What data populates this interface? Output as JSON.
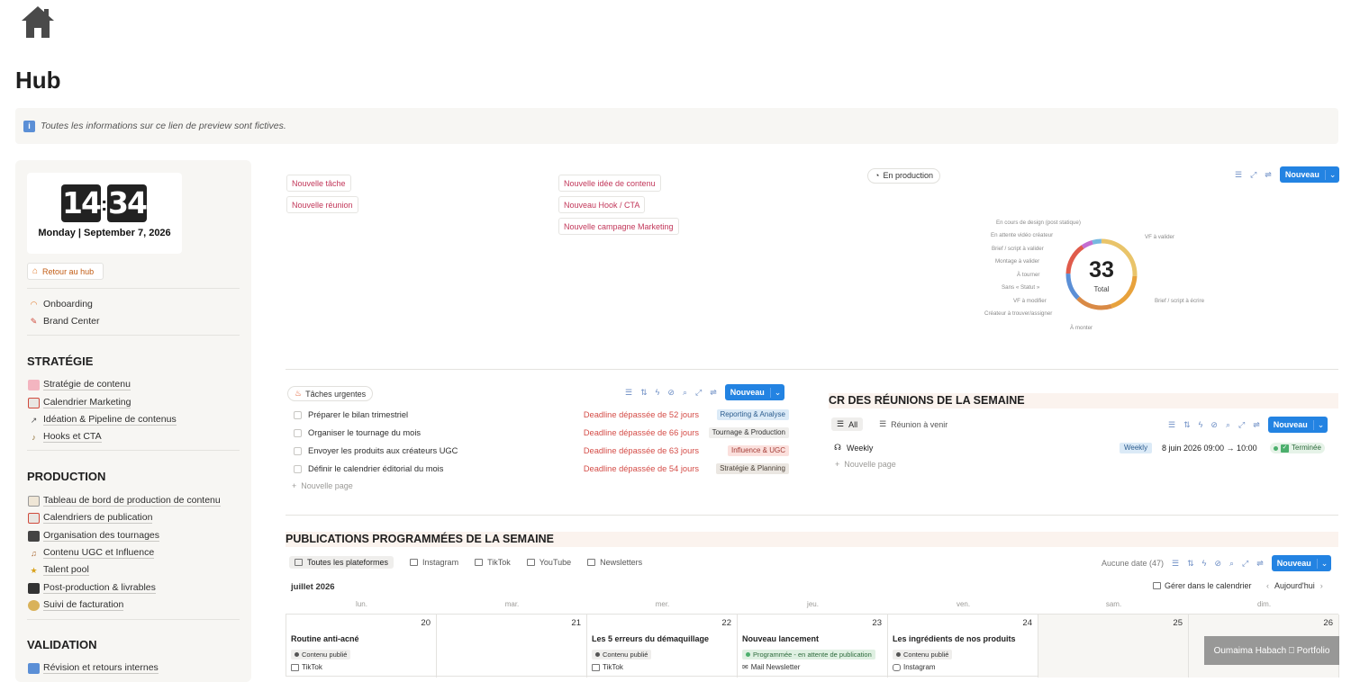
{
  "page": {
    "title": "Hub",
    "callout": "Toutes les informations sur ce lien de preview sont fictives."
  },
  "clock": {
    "hours": "14",
    "minutes": "34",
    "date": "Monday | September 7, 2026"
  },
  "sidebar": {
    "back_label": "Retour au hub",
    "top_items": [
      {
        "label": "Onboarding",
        "icon": "rainbow-icon"
      },
      {
        "label": "Brand Center",
        "icon": "pin-icon"
      }
    ],
    "sections": [
      {
        "title": "STRATÉGIE",
        "items": [
          {
            "label": "Stratégie de contenu",
            "icon": "brain-icon"
          },
          {
            "label": "Calendrier Marketing",
            "icon": "calendar-icon"
          },
          {
            "label": "Idéation & Pipeline de contenus",
            "icon": "arrow-icon"
          },
          {
            "label": "Hooks et CTA",
            "icon": "hook-icon"
          }
        ]
      },
      {
        "title": "PRODUCTION",
        "items": [
          {
            "label": "Tableau de bord de production de contenu",
            "icon": "notepad-icon"
          },
          {
            "label": "Calendriers de publication",
            "icon": "calendar-icon"
          },
          {
            "label": "Organisation des tournages",
            "icon": "camera-icon"
          },
          {
            "label": "Contenu UGC et Influence",
            "icon": "guitar-icon"
          },
          {
            "label": "Talent pool",
            "icon": "star-icon"
          },
          {
            "label": "Post-production & livrables",
            "icon": "screen-icon"
          },
          {
            "label": "Suivi de facturation",
            "icon": "money-bag-icon"
          }
        ]
      },
      {
        "title": "VALIDATION",
        "items": [
          {
            "label": "Révision et retours internes",
            "icon": "refresh-icon"
          }
        ]
      }
    ]
  },
  "quick_buttons": {
    "col1": [
      "Nouvelle tâche",
      "Nouvelle réunion"
    ],
    "col2": [
      "Nouvelle idée de contenu",
      "Nouveau Hook / CTA",
      "Nouvelle campagne Marketing"
    ]
  },
  "production": {
    "view_label": "En production",
    "new_label": "Nouveau",
    "total": "33",
    "total_label": "Total",
    "labels_left": [
      "En cours de design (post statique)",
      "En attente vidéo créateur",
      "Brief / script à valider",
      "Montage à valider",
      "À tourner",
      "Sans « Statut »",
      "VF à modifier",
      "Créateur à trouver/assigner"
    ],
    "labels_right": [
      "VF à valider",
      "Brief / script à écrire"
    ],
    "label_bottom": "À monter",
    "colors": [
      "#e8a23c",
      "#d98a46",
      "#5b8fd6",
      "#e05b4b",
      "#c46dd0",
      "#76b8e0",
      "#e9c46a"
    ]
  },
  "urgent": {
    "view_label": "Tâches urgentes",
    "new_label": "Nouveau",
    "new_page": "Nouvelle page",
    "rows": [
      {
        "title": "Préparer le bilan trimestriel",
        "deadline": "Deadline dépassée de 52 jours",
        "category": "Reporting & Analyse",
        "bg": "#dbeaf7",
        "fg": "#2c5d8f"
      },
      {
        "title": "Organiser le tournage du mois",
        "deadline": "Deadline dépassée de 66 jours",
        "category": "Tournage & Production",
        "bg": "#efeeec",
        "fg": "#333333"
      },
      {
        "title": "Envoyer les produits aux créateurs UGC",
        "deadline": "Deadline dépassée de 63 jours",
        "category": "Influence & UGC",
        "bg": "#fbe0dd",
        "fg": "#a33b35"
      },
      {
        "title": "Définir le calendrier éditorial du mois",
        "deadline": "Deadline dépassée de 54 jours",
        "category": "Stratégie & Planning",
        "bg": "#ebe7e2",
        "fg": "#4a4036"
      }
    ]
  },
  "meetings": {
    "title": "CR DES RÉUNIONS DE LA SEMAINE",
    "tab_all": "All",
    "tab_upcoming": "Réunion à venir",
    "new_label": "Nouveau",
    "new_page": "Nouvelle page",
    "row": {
      "title": "Weekly",
      "tag": "Weekly",
      "date": "8 juin 2026 09:00 → 10:00",
      "status": "Terminée"
    }
  },
  "publications": {
    "title": "PUBLICATIONS PROGRAMMÉES DE LA SEMAINE",
    "tabs": [
      "Toutes les plateformes",
      "Instagram",
      "TikTok",
      "YouTube",
      "Newsletters"
    ],
    "no_date": "Aucune date (47)",
    "new_label": "Nouveau",
    "month": "juillet 2026",
    "manage": "Gérer dans le calendrier",
    "today": "Aujourd'hui",
    "days": [
      "lun.",
      "mar.",
      "mer.",
      "jeu.",
      "ven.",
      "sam.",
      "dim."
    ],
    "dates": [
      "20",
      "21",
      "22",
      "23",
      "24",
      "25",
      "26"
    ],
    "cards": [
      {
        "day": 0,
        "title": "Routine anti-acné",
        "status": "Contenu publié",
        "platform": "TikTok"
      },
      {
        "day": 2,
        "title": "Les 5 erreurs du démaquillage",
        "status": "Contenu publié",
        "platform": "TikTok"
      },
      {
        "day": 3,
        "title": "Nouveau lancement",
        "status": "Programmée - en attente de publication",
        "platform": "Mail Newsletter"
      },
      {
        "day": 4,
        "title": "Les ingrédients de nos produits",
        "status": "Contenu publié",
        "platform": "Instagram"
      }
    ]
  },
  "watermark": "Oumaima Habach ⎕ Portfolio"
}
